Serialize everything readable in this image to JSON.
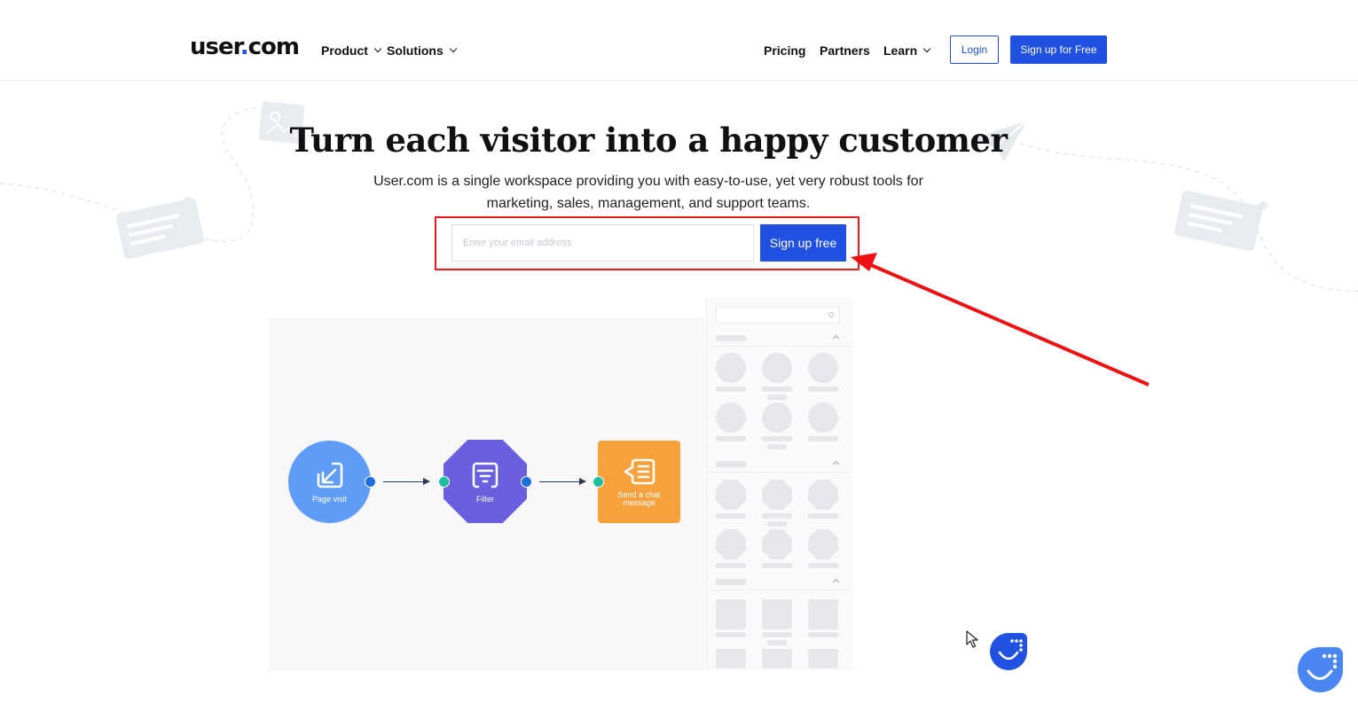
{
  "header": {
    "logo_text": "user",
    "logo_dot": ".",
    "logo_suffix": "com",
    "nav_left": [
      {
        "label": "Product",
        "has_dropdown": true
      },
      {
        "label": "Solutions",
        "has_dropdown": true
      }
    ],
    "nav_right": [
      {
        "label": "Pricing",
        "has_dropdown": false
      },
      {
        "label": "Partners",
        "has_dropdown": false
      },
      {
        "label": "Learn",
        "has_dropdown": true
      }
    ],
    "login_label": "Login",
    "signup_label": "Sign up for Free"
  },
  "hero": {
    "title": "Turn each visitor into a happy customer",
    "subtitle_line1": "User.com is a single workspace providing you with easy-to-use, yet very robust tools for",
    "subtitle_line2": "marketing, sales, management, and support teams.",
    "email_placeholder": "Enter your email address",
    "signup_button": "Sign up free"
  },
  "flow": {
    "nodes": [
      {
        "label": "Page visit",
        "icon": "edit-arrow-icon",
        "shape": "circle",
        "color": "#5e9cf7"
      },
      {
        "label": "Filter",
        "icon": "filter-list-icon",
        "shape": "octagon",
        "color": "#6a5fdf"
      },
      {
        "label_line1": "Send a chat",
        "label_line2": "message",
        "icon": "chat-message-icon",
        "shape": "square",
        "color": "#f7a13c"
      }
    ]
  },
  "colors": {
    "accent": "#2151e0",
    "highlight": "#e41e1e"
  },
  "widgets": {
    "chat_icon": "chat-bubble-icon",
    "cursor_icon": "mouse-pointer-icon"
  }
}
